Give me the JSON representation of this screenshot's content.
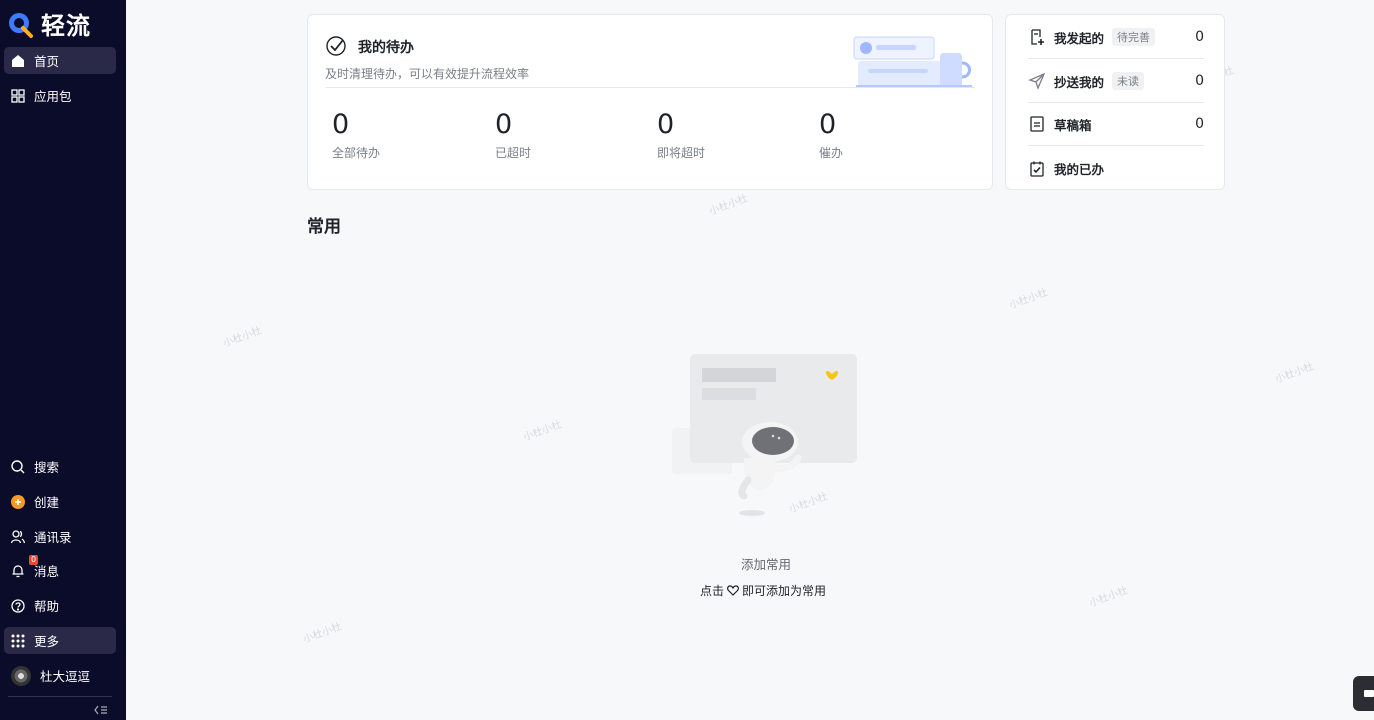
{
  "app": {
    "name": "轻流"
  },
  "sidebar": {
    "top_items": [
      {
        "label": "首页",
        "icon": "home-icon",
        "active": true
      },
      {
        "label": "应用包",
        "icon": "grid-icon",
        "active": false
      }
    ],
    "bottom_items": [
      {
        "label": "搜索",
        "icon": "search-icon"
      },
      {
        "label": "创建",
        "icon": "plus-circle-icon"
      },
      {
        "label": "通讯录",
        "icon": "contacts-icon"
      },
      {
        "label": "消息",
        "icon": "bell-icon",
        "badge": "0"
      },
      {
        "label": "帮助",
        "icon": "help-icon"
      },
      {
        "label": "更多",
        "icon": "apps-icon"
      },
      {
        "label": "杜大逗逗",
        "icon": "avatar"
      }
    ],
    "collapse_icon": "collapse-icon"
  },
  "todo": {
    "title": "我的待办",
    "subtitle": "及时清理待办，可以有效提升流程效率",
    "stats": [
      {
        "value": "0",
        "label": "全部待办"
      },
      {
        "value": "0",
        "label": "已超时"
      },
      {
        "value": "0",
        "label": "即将超时"
      },
      {
        "value": "0",
        "label": "催办"
      }
    ]
  },
  "side_panel": {
    "rows": [
      {
        "label": "我发起的",
        "tag": "待完善",
        "count": "0",
        "icon": "doc-plus-icon"
      },
      {
        "label": "抄送我的",
        "tag": "未读",
        "count": "0",
        "icon": "send-icon"
      },
      {
        "label": "草稿箱",
        "tag": "",
        "count": "0",
        "icon": "draft-icon"
      },
      {
        "label": "我的已办",
        "tag": "",
        "count": "",
        "icon": "calendar-check-icon"
      }
    ]
  },
  "common": {
    "title": "常用",
    "empty_title": "添加常用",
    "hint_before": "点击",
    "hint_after": "即可添加为常用"
  },
  "watermark_text": "小杜小杜",
  "colors": {
    "sidebar_bg": "#0b0b2a",
    "accent": "#1f6fff",
    "create_orange": "#f59a23"
  }
}
